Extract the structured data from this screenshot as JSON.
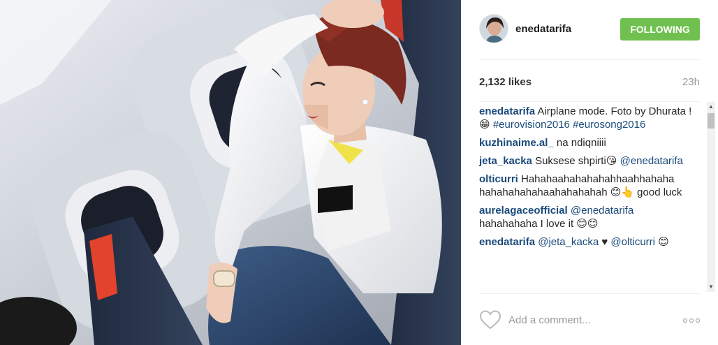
{
  "post": {
    "author": "enedatarifa",
    "follow_label": "FOLLOWING",
    "likes": "2,132 likes",
    "time": "23h"
  },
  "comments": [
    {
      "user": "enedatarifa",
      "parts": [
        {
          "t": "text",
          "v": " Airplane mode. Foto by Dhurata ! 😁 "
        },
        {
          "t": "tag",
          "v": "#eurovision2016"
        },
        {
          "t": "text",
          "v": " "
        },
        {
          "t": "tag",
          "v": "#eurosong2016"
        }
      ]
    },
    {
      "user": "kuzhinaime.al_",
      "parts": [
        {
          "t": "text",
          "v": " na ndiqniiii"
        }
      ]
    },
    {
      "user": "jeta_kacka",
      "parts": [
        {
          "t": "text",
          "v": " Suksese shpirti😘 "
        },
        {
          "t": "tag",
          "v": "@enedatarifa"
        }
      ]
    },
    {
      "user": "olticurri",
      "parts": [
        {
          "t": "text",
          "v": " Hahahaahahahahahhaahhahaha hahahahahahaahahahahah 😊👆 good luck"
        }
      ]
    },
    {
      "user": "aurelagaceofficial",
      "parts": [
        {
          "t": "text",
          "v": " "
        },
        {
          "t": "tag",
          "v": "@enedatarifa"
        },
        {
          "t": "text",
          "v": " hahahahaha I love it 😊😊"
        }
      ]
    },
    {
      "user": "enedatarifa",
      "parts": [
        {
          "t": "text",
          "v": " "
        },
        {
          "t": "tag",
          "v": "@jeta_kacka"
        },
        {
          "t": "text",
          "v": " ♥ "
        },
        {
          "t": "tag",
          "v": "@olticurri"
        },
        {
          "t": "text",
          "v": " 😊"
        }
      ]
    }
  ],
  "footer": {
    "comment_placeholder": "Add a comment...",
    "like_icon": "heart-outline-icon",
    "more_icon": "more-options-icon"
  },
  "colors": {
    "follow_button": "#70c050",
    "link": "#1a4a7a"
  }
}
